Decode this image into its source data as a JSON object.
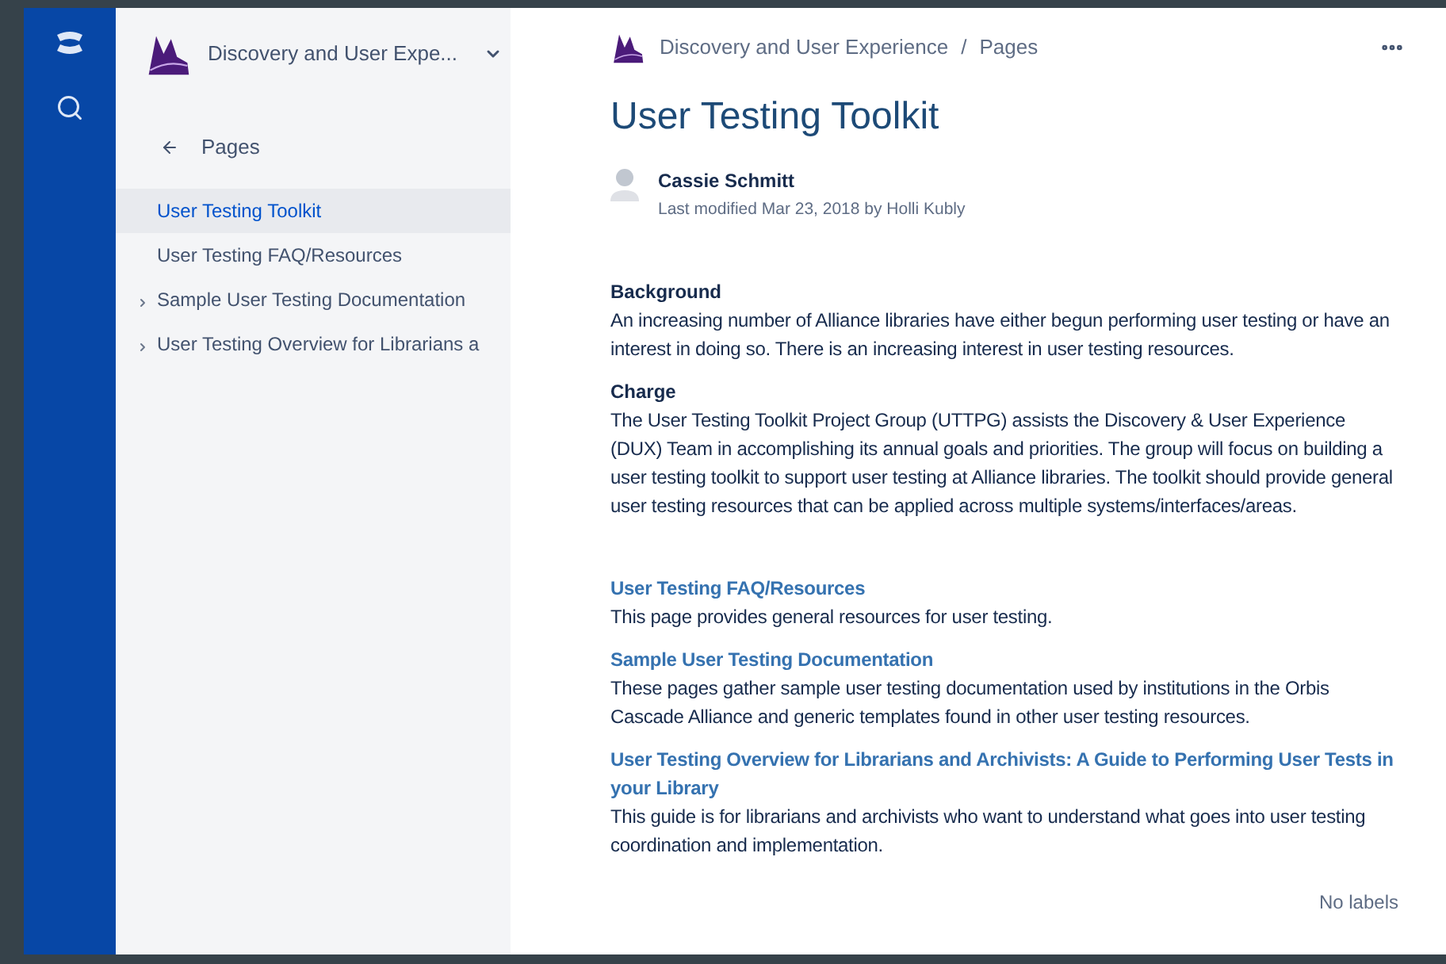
{
  "space": {
    "name": "Discovery and User Expe..."
  },
  "sidebar": {
    "back_label": "Pages",
    "items": [
      {
        "label": "User Testing Toolkit",
        "kind": "leaf",
        "selected": true
      },
      {
        "label": "User Testing FAQ/Resources",
        "kind": "leaf",
        "selected": false
      },
      {
        "label": "Sample User Testing Documentation",
        "kind": "parent",
        "selected": false
      },
      {
        "label": "User Testing Overview for Librarians a",
        "kind": "parent",
        "selected": false
      }
    ]
  },
  "breadcrumbs": {
    "separator": "/",
    "items": [
      "Discovery and User Experience",
      "Pages"
    ]
  },
  "page": {
    "title": "User Testing Toolkit",
    "author": "Cassie Schmitt",
    "modified": "Last modified Mar 23, 2018 by Holli Kubly",
    "sections": [
      {
        "heading": "Background",
        "text": "An increasing number of Alliance libraries have either begun performing user testing or have an interest in doing so. There is an increasing interest in user testing resources."
      },
      {
        "heading": "Charge",
        "text": "The User Testing Toolkit Project Group (UTTPG) assists the Discovery & User Experience (DUX) Team in accomplishing its annual goals and priorities. The group will focus on building a user testing toolkit to support user testing at Alliance libraries. The toolkit should provide general user testing resources that can be applied across multiple systems/interfaces/areas."
      }
    ],
    "child_pages": [
      {
        "title": "User Testing FAQ/Resources",
        "excerpt": "This page provides general resources for user testing."
      },
      {
        "title": "Sample User Testing Documentation",
        "excerpt": "These pages gather sample user testing documentation used by institutions in the Orbis Cascade Alliance and generic templates found in other user testing resources."
      },
      {
        "title": "User Testing Overview for Librarians and Archivists: A Guide to Performing User Tests in your Library",
        "excerpt": "This guide is for librarians and archivists who want to understand what goes into user testing coordination and implementation."
      }
    ],
    "labels": "No labels"
  }
}
